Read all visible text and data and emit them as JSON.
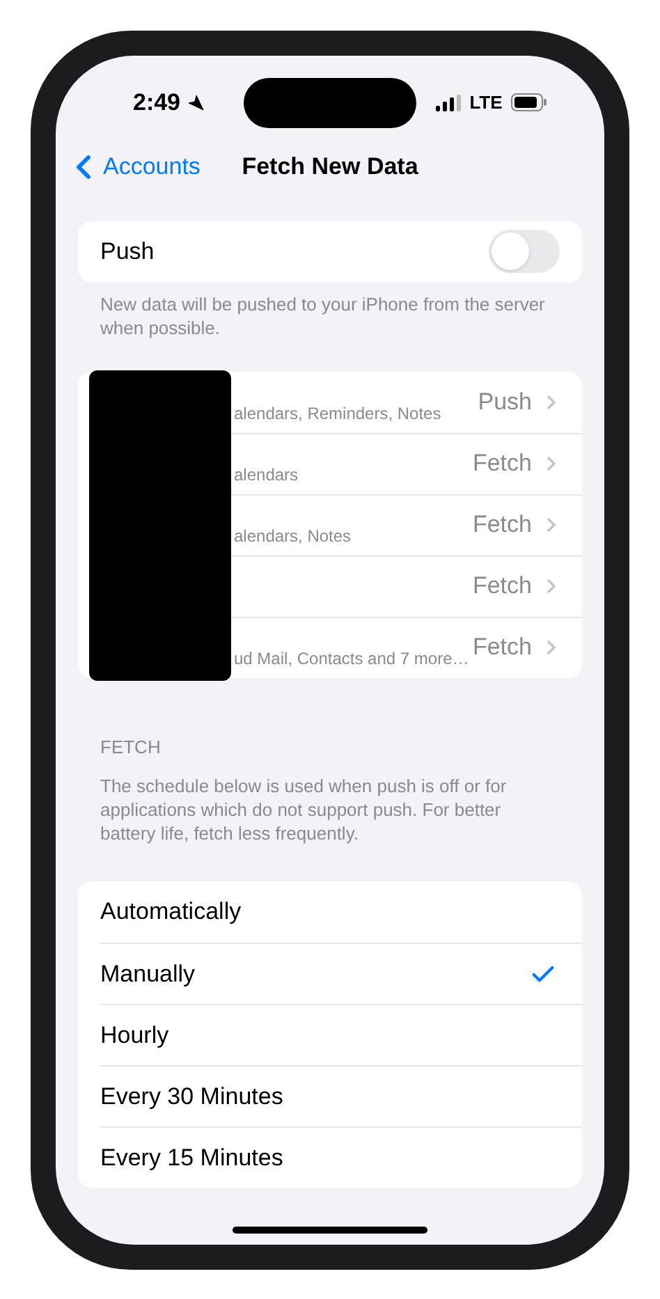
{
  "status_bar": {
    "time": "2:49",
    "network": "LTE"
  },
  "nav": {
    "back": "Accounts",
    "title": "Fetch New Data"
  },
  "push": {
    "label": "Push",
    "on": false,
    "footer": "New data will be pushed to your iPhone from the server when possible."
  },
  "accounts": [
    {
      "subtitle": "alendars, Reminders, Notes",
      "value": "Push"
    },
    {
      "subtitle": "alendars",
      "value": "Fetch"
    },
    {
      "subtitle": "alendars, Notes",
      "value": "Fetch"
    },
    {
      "value": "Fetch"
    },
    {
      "subtitle": "ud Mail, Contacts and 7 more…",
      "value": "Fetch"
    }
  ],
  "fetch": {
    "header": "FETCH",
    "description": "The schedule below is used when push is off or for applications which do not support push. For better battery life, fetch less frequently.",
    "options": [
      {
        "label": "Automatically",
        "selected": false
      },
      {
        "label": "Manually",
        "selected": true
      },
      {
        "label": "Hourly",
        "selected": false
      },
      {
        "label": "Every 30 Minutes",
        "selected": false
      },
      {
        "label": "Every 15 Minutes",
        "selected": false
      }
    ]
  }
}
